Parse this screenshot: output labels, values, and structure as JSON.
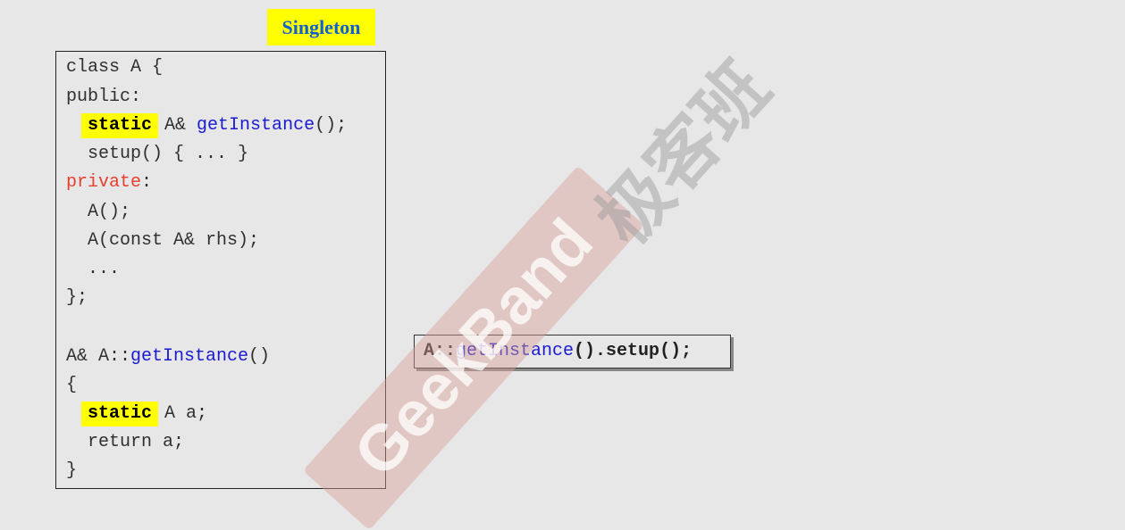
{
  "title": "Singleton",
  "code": {
    "l1": "class A {",
    "l2": "public:",
    "l3_kw": "static",
    "l3_a": "A& ",
    "l3_fn": "getInstance",
    "l3_b": "();",
    "l4": "  setup() { ... }",
    "l5_kw": "private",
    "l5_b": ":",
    "l6": "  A();",
    "l7": "  A(const A& rhs);",
    "l8": "  ...",
    "l9": "};",
    "l10_a": "A& A::",
    "l10_fn": "getInstance",
    "l10_b": "()",
    "l11": "{",
    "l12_kw": "static",
    "l12_a": "A a;",
    "l13": "  return a;",
    "l14": "}"
  },
  "call": {
    "a": "A::",
    "fn": "getInstance",
    "b": "().setup();"
  },
  "watermark": {
    "latin": "GeekBand",
    "cjk": "极客班"
  }
}
